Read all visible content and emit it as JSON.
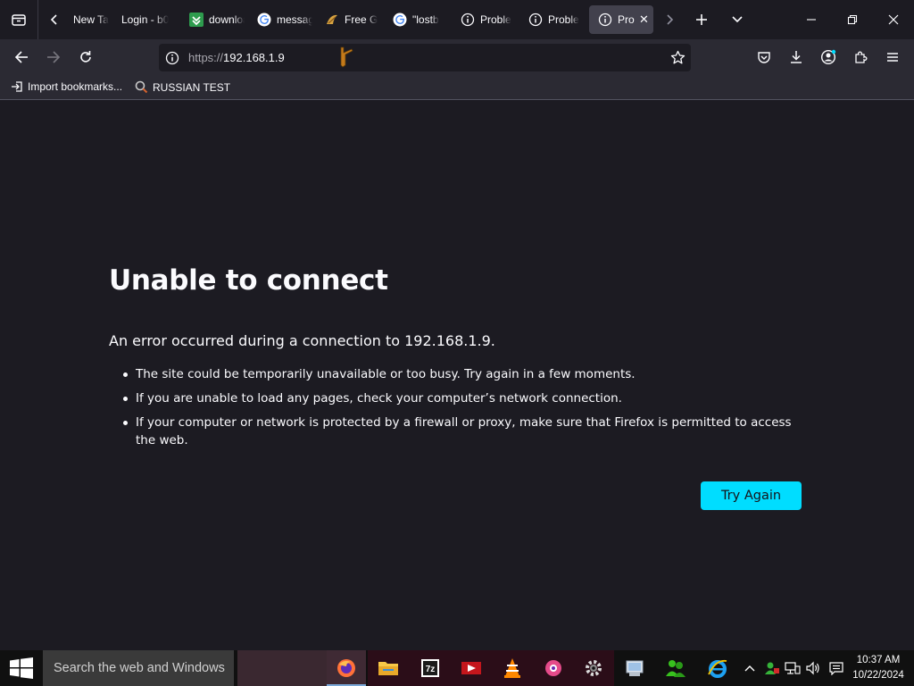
{
  "browser": {
    "tabs": [
      {
        "label": "New Tab",
        "favicon": "firefox-newtab",
        "active": false
      },
      {
        "label": "Login - b0",
        "favicon": "none",
        "active": false
      },
      {
        "label": "download",
        "favicon": "green-download",
        "active": false
      },
      {
        "label": "message",
        "favicon": "google",
        "active": false
      },
      {
        "label": "Free G",
        "favicon": "tree-logo",
        "active": false
      },
      {
        "label": "\"lostb",
        "favicon": "google",
        "active": false
      },
      {
        "label": "Proble",
        "favicon": "info",
        "active": false
      },
      {
        "label": "Proble",
        "favicon": "info",
        "active": false
      },
      {
        "label": "Pro",
        "favicon": "info",
        "active": true
      }
    ],
    "url": {
      "scheme": "https://",
      "host": "192.168.1.9"
    },
    "bookmarks": [
      {
        "label": "Import bookmarks...",
        "icon": "import-icon"
      },
      {
        "label": "RUSSIAN TEST",
        "icon": "search-globe-icon"
      }
    ]
  },
  "error_page": {
    "title": "Unable to connect",
    "description": "An error occurred during a connection to 192.168.1.9.",
    "reasons": [
      "The site could be temporarily unavailable or too busy. Try again in a few moments.",
      "If you are unable to load any pages, check your computer’s network connection.",
      "If your computer or network is protected by a firewall or proxy, make sure that Firefox is permitted to access the web."
    ],
    "button_label": "Try Again"
  },
  "taskbar": {
    "search_placeholder": "Search the web and Windows",
    "time": "10:37 AM",
    "date": "10/22/2024"
  },
  "colors": {
    "accent": "#00ddff",
    "page_bg": "#1c1b22",
    "toolbar_bg": "#2b2a33"
  }
}
